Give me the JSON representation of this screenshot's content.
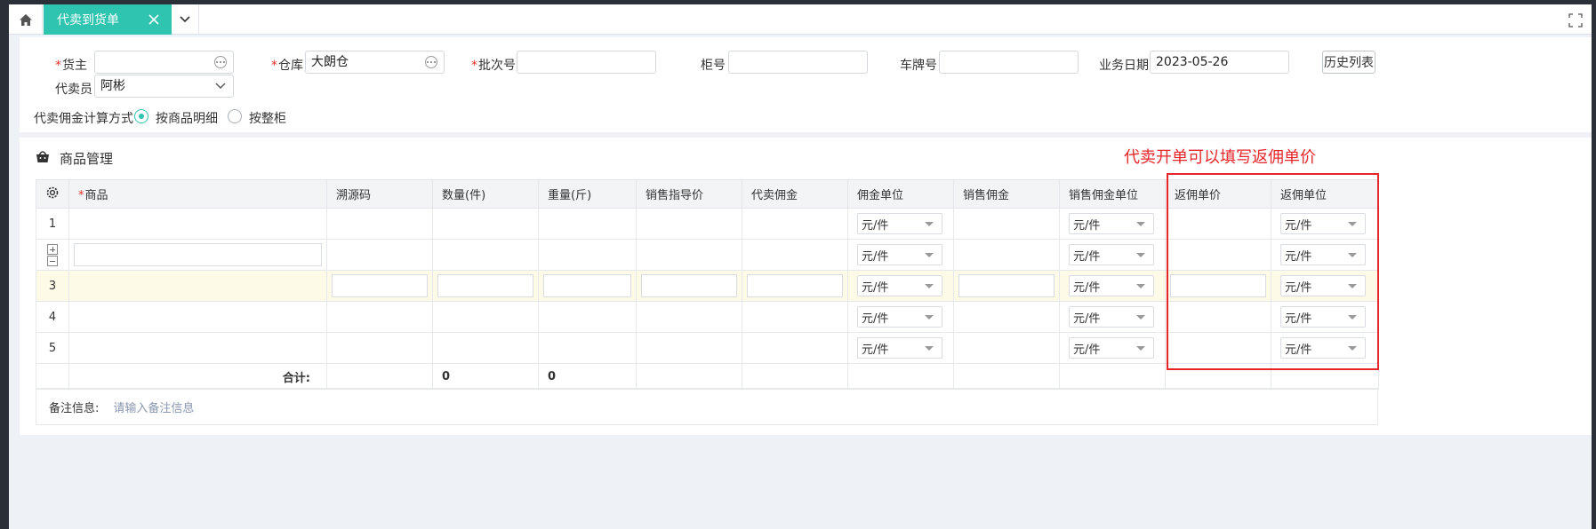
{
  "tabs": {
    "active_label": "代卖到货单"
  },
  "form": {
    "owner_label": "货主",
    "owner_value": "",
    "warehouse_label": "仓库",
    "warehouse_value": "大朗仓",
    "batch_label": "批次号",
    "batch_value": "",
    "cabinet_label": "柜号",
    "cabinet_value": "",
    "plate_label": "车牌号",
    "plate_value": "",
    "date_label": "业务日期",
    "date_value": "2023-05-26",
    "history_button": "历史列表",
    "agent_label": "代卖员",
    "agent_value": "阿彬",
    "commission_method_label": "代卖佣金计算方式",
    "radio_options": [
      "按商品明细",
      "按整柜"
    ],
    "radio_selected": "按商品明细"
  },
  "goods": {
    "title": "商品管理",
    "annotation": "代卖开单可以填写返佣单价",
    "columns": [
      "商品",
      "溯源码",
      "数量(件)",
      "重量(斤)",
      "销售指导价",
      "代卖佣金",
      "佣金单位",
      "销售佣金",
      "销售佣金单位",
      "返佣单价",
      "返佣单位"
    ],
    "unit_option": "元/件",
    "rows": [
      "1",
      "",
      "3",
      "4",
      "5"
    ],
    "total_label": "合计:",
    "total_qty": "0",
    "total_weight": "0",
    "remark_label": "备注信息:",
    "remark_placeholder": "请输入备注信息"
  },
  "colors": {
    "accent": "#2ec4b0",
    "annotation": "#e6262a",
    "required": "#e5332a"
  },
  "icons": [
    "home-icon",
    "close-icon",
    "chevron-down-icon",
    "fullscreen-icon",
    "ellipsis-icon",
    "basket-icon",
    "gear-icon",
    "plus-icon",
    "minus-icon"
  ]
}
